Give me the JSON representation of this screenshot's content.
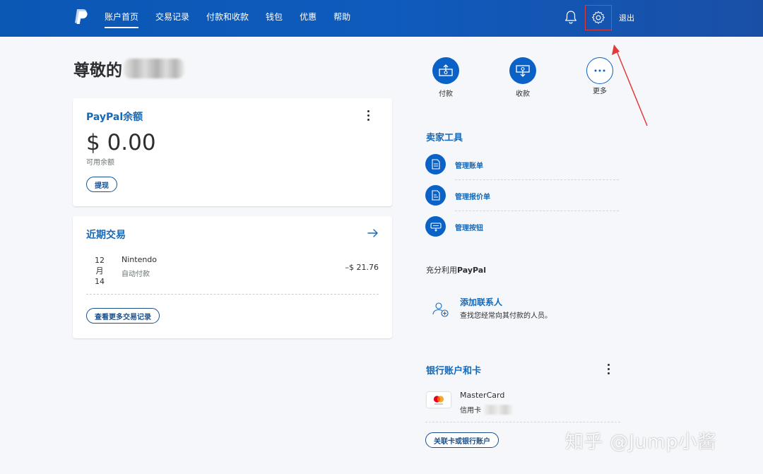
{
  "header": {
    "nav": [
      {
        "label": "账户首页",
        "active": true
      },
      {
        "label": "交易记录"
      },
      {
        "label": "付款和收款"
      },
      {
        "label": "钱包"
      },
      {
        "label": "优惠"
      },
      {
        "label": "帮助"
      }
    ],
    "logout_label": "退出",
    "icons": [
      "paypal-logo",
      "bell-icon",
      "gear-icon"
    ]
  },
  "greeting": "尊敬的",
  "balance": {
    "title": "PayPal余额",
    "amount": "$ 0.00",
    "subtitle": "可用余额",
    "withdraw_label": "提现"
  },
  "recent": {
    "title": "近期交易",
    "transactions": [
      {
        "month_day": [
          "12",
          "月",
          "14"
        ],
        "name": "Nintendo",
        "type": "自动付款",
        "amount": "–$ 21.76"
      }
    ],
    "more_label": "查看更多交易记录"
  },
  "quick_actions": [
    {
      "label": "付款",
      "icon": "send-money-icon"
    },
    {
      "label": "收款",
      "icon": "request-money-icon"
    },
    {
      "label": "更多",
      "icon": "more-icon"
    }
  ],
  "seller_tools": {
    "title": "卖家工具",
    "items": [
      {
        "label": "管理账单",
        "icon": "invoice-icon"
      },
      {
        "label": "管理报价单",
        "icon": "estimate-icon"
      },
      {
        "label": "管理按钮",
        "icon": "button-icon"
      }
    ]
  },
  "leverage": {
    "prefix": "充分利用",
    "brand": "PayPal",
    "contact_title": "添加联系人",
    "contact_desc": "查找您经常向其付款的人员。"
  },
  "banks": {
    "title": "银行账户和卡",
    "card_name": "MasterCard",
    "card_type": "信用卡",
    "link_label": "关联卡或银行账户"
  },
  "watermark": "知乎 @Jump小酱",
  "colors": {
    "header_blue": "#0b57b4",
    "accent_blue": "#1569b8",
    "annotation_red": "#e03a3a"
  }
}
